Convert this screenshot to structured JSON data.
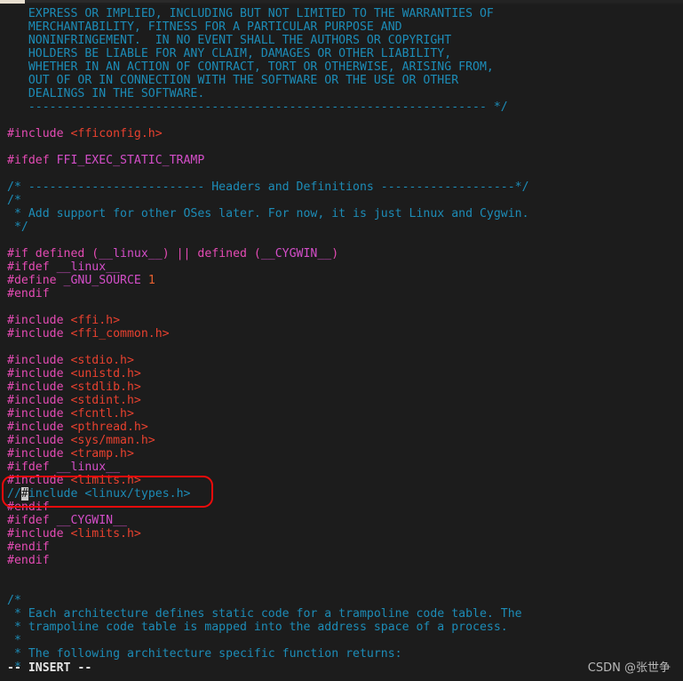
{
  "window": {
    "chrome": {
      "tab_strip_visible": true,
      "tab_left_color": "#e8dfd0",
      "tab_active_color": "#2a2a2a"
    }
  },
  "editor": {
    "application": "vim",
    "background_color": "#1c1c1c",
    "colors": {
      "comment": "#1c8cb7",
      "preprocessor": "#e44bb4",
      "macro": "#d34ec8",
      "include_path": "#e8412f",
      "number": "#e8612f",
      "cursor": "#c9c9c9",
      "annotation": "#ef0b0b",
      "status_text": "#e6e6e6"
    },
    "lines": [
      {
        "id": 1,
        "segments": [
          {
            "t": "cmt",
            "s": "   EXPRESS OR IMPLIED, INCLUDING BUT NOT LIMITED TO THE WARRANTIES OF"
          }
        ]
      },
      {
        "id": 2,
        "segments": [
          {
            "t": "cmt",
            "s": "   MERCHANTABILITY, FITNESS FOR A PARTICULAR PURPOSE AND"
          }
        ]
      },
      {
        "id": 3,
        "segments": [
          {
            "t": "cmt",
            "s": "   NONINFRINGEMENT.  IN NO EVENT SHALL THE AUTHORS OR COPYRIGHT"
          }
        ]
      },
      {
        "id": 4,
        "segments": [
          {
            "t": "cmt",
            "s": "   HOLDERS BE LIABLE FOR ANY CLAIM, DAMAGES OR OTHER LIABILITY,"
          }
        ]
      },
      {
        "id": 5,
        "segments": [
          {
            "t": "cmt",
            "s": "   WHETHER IN AN ACTION OF CONTRACT, TORT OR OTHERWISE, ARISING FROM,"
          }
        ]
      },
      {
        "id": 6,
        "segments": [
          {
            "t": "cmt",
            "s": "   OUT OF OR IN CONNECTION WITH THE SOFTWARE OR THE USE OR OTHER"
          }
        ]
      },
      {
        "id": 7,
        "segments": [
          {
            "t": "cmt",
            "s": "   DEALINGS IN THE SOFTWARE."
          }
        ]
      },
      {
        "id": 8,
        "segments": [
          {
            "t": "cmt",
            "s": "   ----------------------------------------------------------------- */"
          }
        ]
      },
      {
        "id": 9,
        "segments": []
      },
      {
        "id": 10,
        "segments": [
          {
            "t": "pre",
            "s": "#include "
          },
          {
            "t": "str",
            "s": "<fficonfig.h>"
          }
        ]
      },
      {
        "id": 11,
        "segments": []
      },
      {
        "id": 12,
        "segments": [
          {
            "t": "pre",
            "s": "#ifdef "
          },
          {
            "t": "macro",
            "s": "FFI_EXEC_STATIC_TRAMP"
          }
        ]
      },
      {
        "id": 13,
        "segments": []
      },
      {
        "id": 14,
        "segments": [
          {
            "t": "cmt",
            "s": "/* ------------------------- Headers and Definitions -------------------*/"
          }
        ]
      },
      {
        "id": 15,
        "segments": [
          {
            "t": "cmt",
            "s": "/*"
          }
        ]
      },
      {
        "id": 16,
        "segments": [
          {
            "t": "cmt",
            "s": " * Add support for other OSes later. For now, it is just Linux and Cygwin."
          }
        ]
      },
      {
        "id": 17,
        "segments": [
          {
            "t": "cmt",
            "s": " */"
          }
        ]
      },
      {
        "id": 18,
        "segments": []
      },
      {
        "id": 19,
        "segments": [
          {
            "t": "pre",
            "s": "#if defined ("
          },
          {
            "t": "macro",
            "s": "__linux__"
          },
          {
            "t": "pre",
            "s": ") || defined ("
          },
          {
            "t": "macro",
            "s": "__CYGWIN__"
          },
          {
            "t": "pre",
            "s": ")"
          }
        ]
      },
      {
        "id": 20,
        "segments": [
          {
            "t": "pre",
            "s": "#ifdef "
          },
          {
            "t": "macro",
            "s": "__linux__"
          }
        ]
      },
      {
        "id": 21,
        "segments": [
          {
            "t": "pre",
            "s": "#define "
          },
          {
            "t": "macro",
            "s": "_GNU_SOURCE "
          },
          {
            "t": "num",
            "s": "1"
          }
        ]
      },
      {
        "id": 22,
        "segments": [
          {
            "t": "pre",
            "s": "#endif"
          }
        ]
      },
      {
        "id": 23,
        "segments": []
      },
      {
        "id": 24,
        "segments": [
          {
            "t": "pre",
            "s": "#include "
          },
          {
            "t": "str",
            "s": "<ffi.h>"
          }
        ]
      },
      {
        "id": 25,
        "segments": [
          {
            "t": "pre",
            "s": "#include "
          },
          {
            "t": "str",
            "s": "<ffi_common.h>"
          }
        ]
      },
      {
        "id": 26,
        "segments": []
      },
      {
        "id": 27,
        "segments": [
          {
            "t": "pre",
            "s": "#include "
          },
          {
            "t": "str",
            "s": "<stdio.h>"
          }
        ]
      },
      {
        "id": 28,
        "segments": [
          {
            "t": "pre",
            "s": "#include "
          },
          {
            "t": "str",
            "s": "<unistd.h>"
          }
        ]
      },
      {
        "id": 29,
        "segments": [
          {
            "t": "pre",
            "s": "#include "
          },
          {
            "t": "str",
            "s": "<stdlib.h>"
          }
        ]
      },
      {
        "id": 30,
        "segments": [
          {
            "t": "pre",
            "s": "#include "
          },
          {
            "t": "str",
            "s": "<stdint.h>"
          }
        ]
      },
      {
        "id": 31,
        "segments": [
          {
            "t": "pre",
            "s": "#include "
          },
          {
            "t": "str",
            "s": "<fcntl.h>"
          }
        ]
      },
      {
        "id": 32,
        "segments": [
          {
            "t": "pre",
            "s": "#include "
          },
          {
            "t": "str",
            "s": "<pthread.h>"
          }
        ]
      },
      {
        "id": 33,
        "segments": [
          {
            "t": "pre",
            "s": "#include "
          },
          {
            "t": "str",
            "s": "<sys/mman.h>"
          }
        ]
      },
      {
        "id": 34,
        "segments": [
          {
            "t": "pre",
            "s": "#include "
          },
          {
            "t": "str",
            "s": "<tramp.h>"
          }
        ]
      },
      {
        "id": 35,
        "segments": [
          {
            "t": "pre",
            "s": "#ifdef "
          },
          {
            "t": "macro",
            "s": "__linux__"
          }
        ]
      },
      {
        "id": 36,
        "segments": [
          {
            "t": "pre",
            "s": "#include "
          },
          {
            "t": "str",
            "s": "<limits.h>"
          }
        ]
      },
      {
        "id": 37,
        "segments": [
          {
            "t": "cmt",
            "s": "//"
          },
          {
            "t": "cmt cursor",
            "s": "#"
          },
          {
            "t": "cmt",
            "s": "include <linux/types.h>"
          }
        ]
      },
      {
        "id": 38,
        "segments": [
          {
            "t": "pre",
            "s": "#endif"
          }
        ]
      },
      {
        "id": 39,
        "segments": [
          {
            "t": "pre",
            "s": "#ifdef "
          },
          {
            "t": "macro",
            "s": "__CYGWIN__"
          }
        ]
      },
      {
        "id": 40,
        "segments": [
          {
            "t": "pre",
            "s": "#include "
          },
          {
            "t": "str",
            "s": "<limits.h>"
          }
        ]
      },
      {
        "id": 41,
        "segments": [
          {
            "t": "pre",
            "s": "#endif"
          }
        ]
      },
      {
        "id": 42,
        "segments": [
          {
            "t": "pre",
            "s": "#endif"
          }
        ]
      },
      {
        "id": 43,
        "segments": []
      },
      {
        "id": 44,
        "segments": []
      },
      {
        "id": 45,
        "segments": [
          {
            "t": "cmt",
            "s": "/*"
          }
        ]
      },
      {
        "id": 46,
        "segments": [
          {
            "t": "cmt",
            "s": " * Each architecture defines static code for a trampoline code table. The"
          }
        ]
      },
      {
        "id": 47,
        "segments": [
          {
            "t": "cmt",
            "s": " * trampoline code table is mapped into the address space of a process."
          }
        ]
      },
      {
        "id": 48,
        "segments": [
          {
            "t": "cmt",
            "s": " *"
          }
        ]
      },
      {
        "id": 49,
        "segments": [
          {
            "t": "cmt",
            "s": " * The following architecture specific function returns:"
          }
        ]
      },
      {
        "id": 50,
        "segments": [
          {
            "t": "cmt",
            "s": " *"
          }
        ]
      }
    ]
  },
  "annotation": {
    "shape": "rounded-rectangle",
    "color": "#ef0b0b",
    "targets": [
      "#include <limits.h>",
      "//#include <linux/types.h>"
    ]
  },
  "status_bar": {
    "mode_label": "-- INSERT --"
  },
  "watermark": {
    "text": "CSDN @张世争"
  }
}
